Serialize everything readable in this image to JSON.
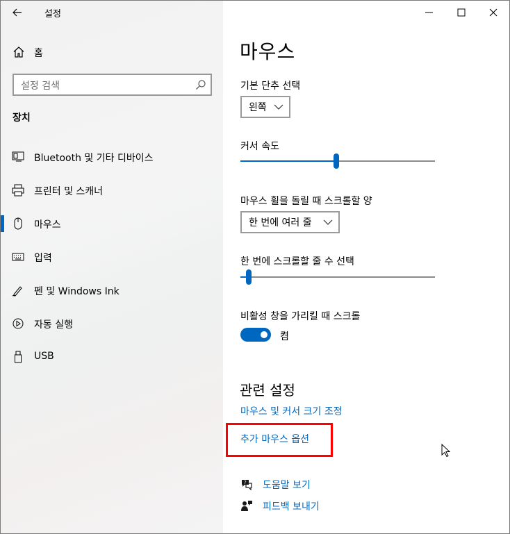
{
  "window": {
    "title": "설정"
  },
  "sidebar": {
    "home_label": "홈",
    "search_placeholder": "설정 검색",
    "section_title": "장치",
    "items": [
      {
        "label": "Bluetooth 및 기타 디바이스",
        "icon": "bluetooth-devices-icon"
      },
      {
        "label": "프린터 및 스캐너",
        "icon": "printer-icon"
      },
      {
        "label": "마우스",
        "icon": "mouse-icon",
        "active": true
      },
      {
        "label": "입력",
        "icon": "keyboard-icon"
      },
      {
        "label": "펜 및 Windows Ink",
        "icon": "pen-icon"
      },
      {
        "label": "자동 실행",
        "icon": "autoplay-icon"
      },
      {
        "label": "USB",
        "icon": "usb-icon"
      }
    ]
  },
  "main": {
    "title": "마우스",
    "primary_button": {
      "label": "기본 단추 선택",
      "value": "왼쪽"
    },
    "cursor_speed": {
      "label": "커서 속도",
      "value_fraction": 0.48
    },
    "wheel_scroll": {
      "label": "마우스 휠을 돌릴 때 스크롤할 양",
      "value": "한 번에 여러 줄"
    },
    "lines_to_scroll": {
      "label": "한 번에 스크롤할 줄 수 선택",
      "value_fraction": 0.03
    },
    "inactive_scroll": {
      "label": "비활성 창을 가리킬 때 스크롤",
      "state": "켬",
      "on": true
    },
    "related": {
      "title": "관련 설정",
      "links": [
        "마우스 및 커서 크기 조정",
        "추가 마우스 옵션"
      ]
    },
    "help": [
      {
        "label": "도움말 보기",
        "icon": "help-chat-icon"
      },
      {
        "label": "피드백 보내기",
        "icon": "feedback-icon"
      }
    ]
  },
  "colors": {
    "accent": "#0067c0",
    "highlight": "#ff0000"
  }
}
